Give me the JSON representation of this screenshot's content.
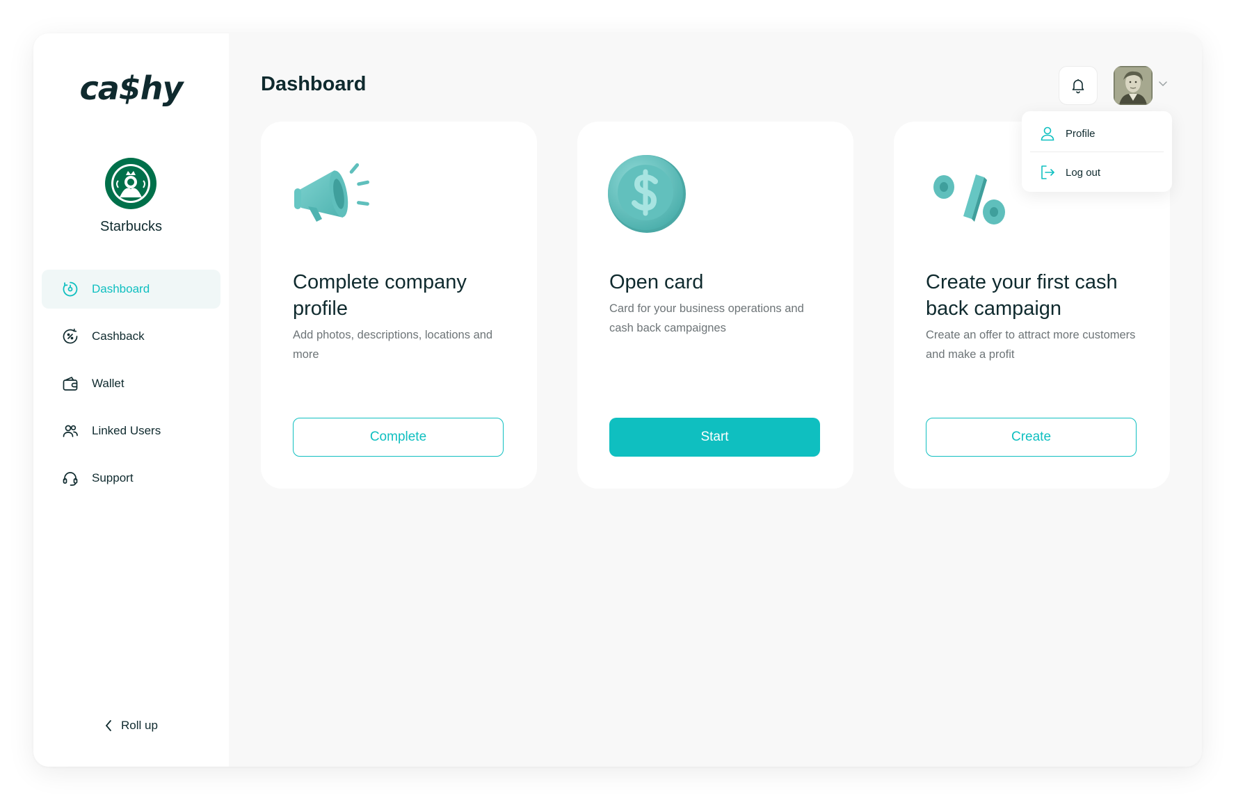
{
  "app": {
    "logo_text": "ca$hy",
    "company_name": "Starbucks",
    "accent_color": "#0fbfc0",
    "text_color": "#0f2a2e"
  },
  "sidebar": {
    "items": [
      {
        "label": "Dashboard",
        "icon": "dashboard-icon",
        "active": true
      },
      {
        "label": "Cashback",
        "icon": "cashback-icon",
        "active": false
      },
      {
        "label": "Wallet",
        "icon": "wallet-icon",
        "active": false
      },
      {
        "label": "Linked Users",
        "icon": "users-icon",
        "active": false
      },
      {
        "label": "Support",
        "icon": "headset-icon",
        "active": false
      }
    ],
    "rollup_label": "Roll up"
  },
  "header": {
    "title": "Dashboard"
  },
  "user_menu": {
    "items": [
      {
        "label": "Profile",
        "icon": "user-icon"
      },
      {
        "label": "Log out",
        "icon": "logout-icon"
      }
    ]
  },
  "cards": [
    {
      "title": "Complete company profile",
      "description": "Add photos, descriptions, locations and more",
      "button": "Complete",
      "illustration": "megaphone-icon"
    },
    {
      "title": "Open card",
      "description": "Card for your business operations and cash back campaignes",
      "button": "Start",
      "illustration": "dollar-coin-icon"
    },
    {
      "title": "Create your first cash back campaign",
      "description": "Create an offer to attract more customers and make a profit",
      "button": "Create",
      "illustration": "percent-icon"
    }
  ]
}
